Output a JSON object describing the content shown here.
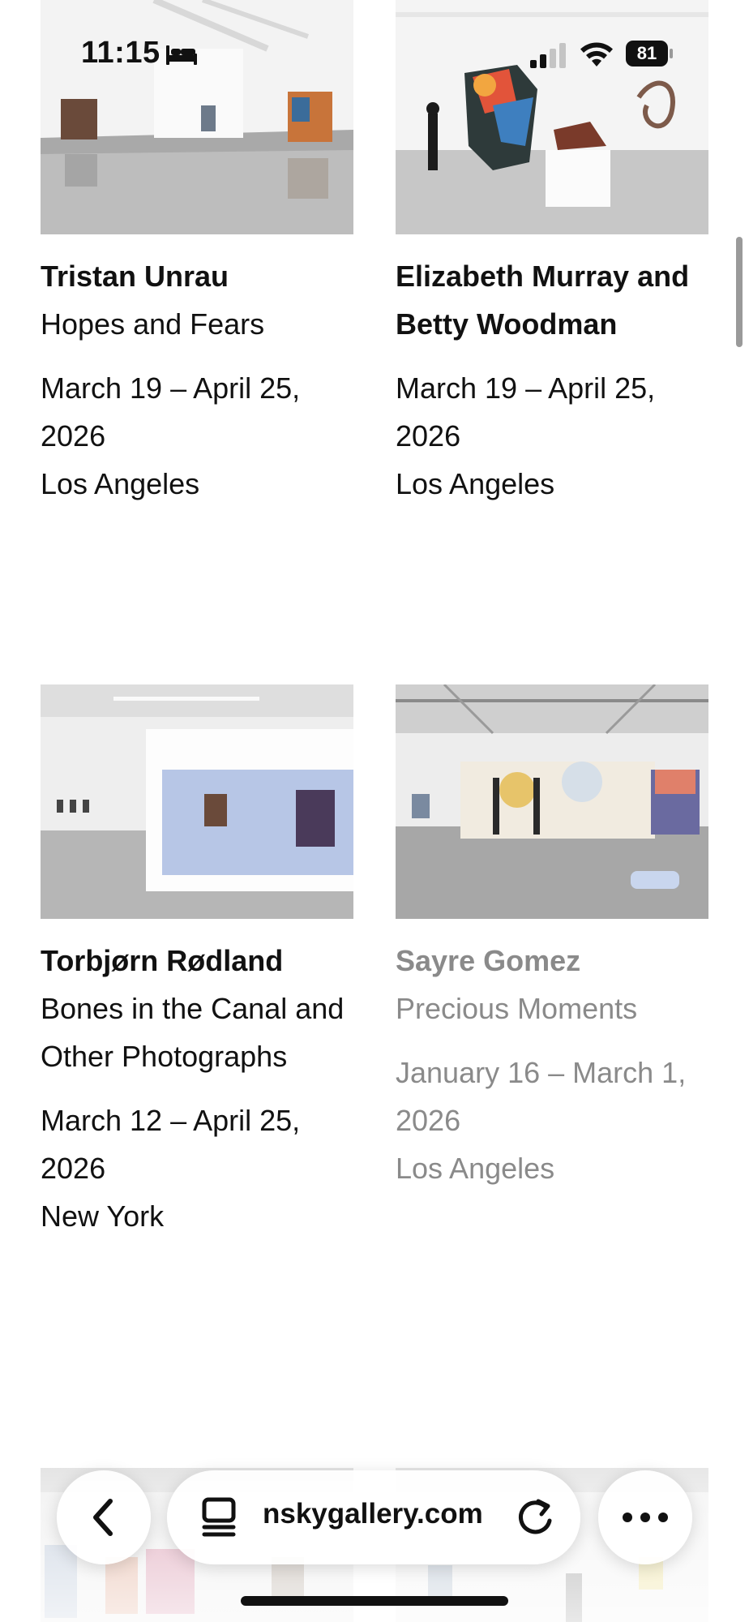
{
  "status_bar": {
    "time": "11:15",
    "battery": "81"
  },
  "browser": {
    "url": "nskygallery.com"
  },
  "exhibitions": [
    {
      "artist": "Tristan Unrau",
      "title": "Hopes and Fears",
      "dates": "March 19 – April 25, 2026",
      "location": "Los Angeles"
    },
    {
      "artist": "Elizabeth Murray and Betty Woodman",
      "title": "",
      "dates": "March 19 – April 25, 2026",
      "location": "Los Angeles"
    },
    {
      "artist": "Torbjørn Rødland",
      "title": "Bones in the Canal and Other Photographs",
      "dates": "March 12 – April 25, 2026",
      "location": "New York"
    },
    {
      "artist": "Sayre Gomez",
      "title": "Precious Moments",
      "dates": "January 16 – March 1, 2026",
      "location": "Los Angeles"
    }
  ]
}
